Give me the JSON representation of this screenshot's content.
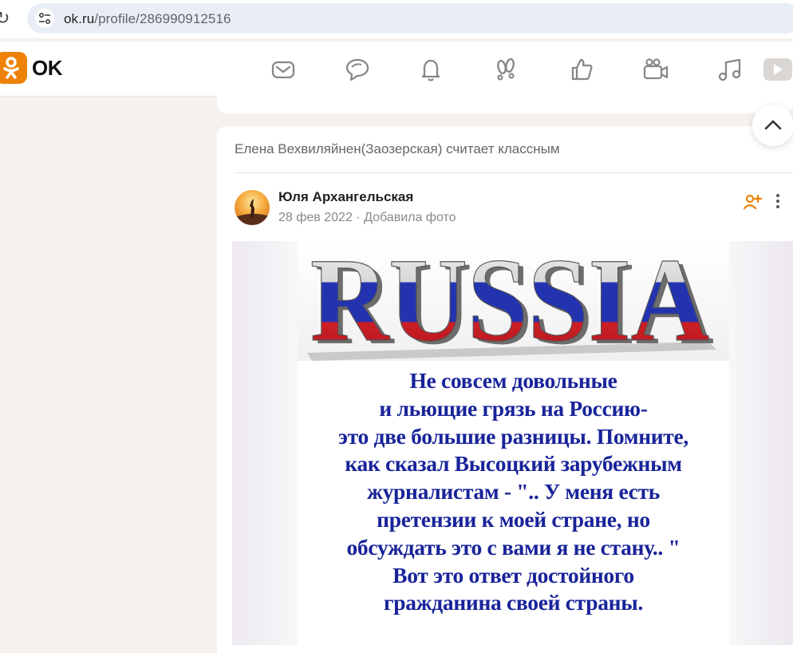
{
  "browser": {
    "url_host": "ok.ru",
    "url_path": "/profile/286990912516"
  },
  "header": {
    "brand": "OK",
    "brand_color": "#ee8208",
    "nav_icons": [
      "messages-icon",
      "discussions-icon",
      "notifications-icon",
      "guests-icon",
      "events-icon",
      "friends-video-icon",
      "music-icon",
      "video-icon"
    ]
  },
  "post": {
    "liked_by": "Елена Вехвиляйнен(Заозерская) считает классным",
    "author": "Юля Архангельская",
    "date": "28 фев 2022",
    "separator": "·",
    "action": "Добавила фото",
    "photo": {
      "banner_word": "RUSSIA",
      "lines": [
        "Не совсем довольные",
        "и льющие грязь на Россию-",
        "это две большие разницы. Помните,",
        "как сказал Высоцкий зарубежным",
        "журналистам  - \".. У меня есть",
        "претензии к моей стране, но",
        "обсуждать это с вами я не стану.. \"",
        "Вот это ответ достойного",
        "гражданина своей страны."
      ],
      "text_color": "#18239a"
    }
  }
}
